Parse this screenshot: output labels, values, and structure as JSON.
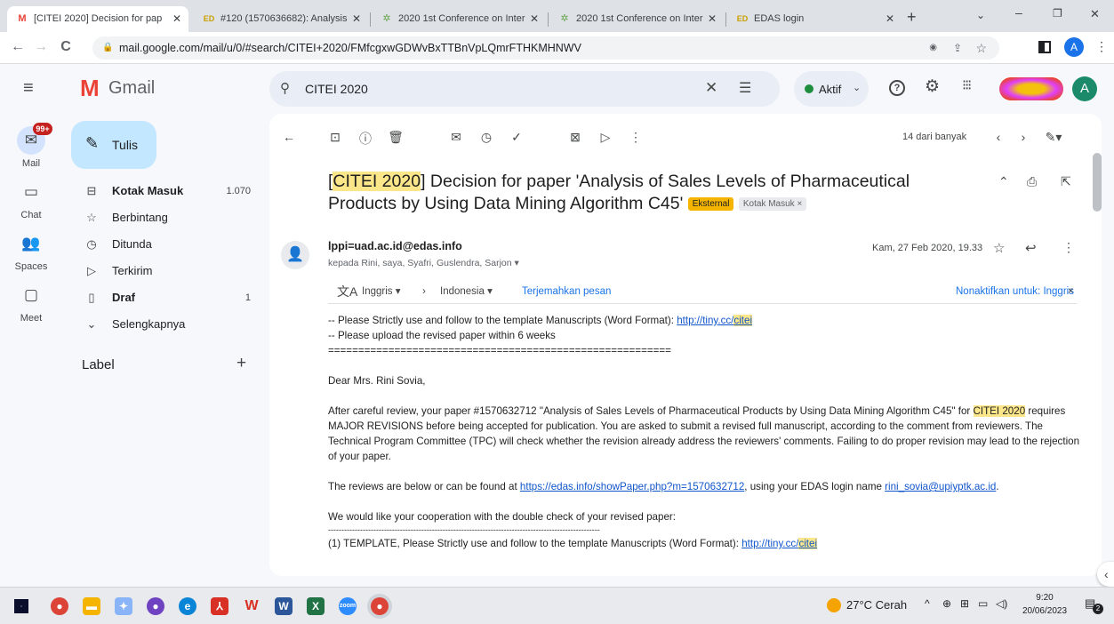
{
  "browser": {
    "tabs": [
      {
        "title": "[CITEI 2020] Decision for pap",
        "icon": "gmail-icon",
        "active": true
      },
      {
        "title": "#120 (1570636682): Analysis",
        "icon": "edas-icon",
        "active": false
      },
      {
        "title": "2020 1st Conference on Inter",
        "icon": "conference-icon",
        "active": false
      },
      {
        "title": "2020 1st Conference on Inter",
        "icon": "conference-icon",
        "active": false
      },
      {
        "title": "EDAS login",
        "icon": "edas-icon",
        "active": false
      }
    ],
    "url": "mail.google.com/mail/u/0/#search/CITEI+2020/FMfcgxwGDWvBxTTBnVpLQmrFTHKMHNWV",
    "profile_letter": "A"
  },
  "gmail": {
    "brand": "Gmail",
    "search_query": "CITEI 2020",
    "status": "Aktif",
    "avatar_letter": "A",
    "compose_label": "Tulis",
    "mail_badge": "99+",
    "rail": [
      {
        "label": "Mail",
        "icon": "mail-icon"
      },
      {
        "label": "Chat",
        "icon": "chat-icon"
      },
      {
        "label": "Spaces",
        "icon": "spaces-icon"
      },
      {
        "label": "Meet",
        "icon": "meet-icon"
      }
    ],
    "nav": [
      {
        "label": "Kotak Masuk",
        "count": "1.070",
        "bold": true,
        "icon": "inbox-icon"
      },
      {
        "label": "Berbintang",
        "count": "",
        "bold": false,
        "icon": "star-icon"
      },
      {
        "label": "Ditunda",
        "count": "",
        "bold": false,
        "icon": "clock-icon"
      },
      {
        "label": "Terkirim",
        "count": "",
        "bold": false,
        "icon": "send-icon"
      },
      {
        "label": "Draf",
        "count": "1",
        "bold": true,
        "icon": "draft-icon"
      },
      {
        "label": "Selengkapnya",
        "count": "",
        "bold": false,
        "icon": "chevron-down-icon"
      }
    ],
    "label_heading": "Label",
    "pager": "14 dari banyak"
  },
  "email": {
    "subject_tag": "CITEI 2020",
    "subject_rest_1": " Decision for paper 'Analysis of Sales Levels of Pharmaceutical",
    "subject_rest_2": "Products by Using Data Mining Algorithm C45'",
    "badge_external": "Eksternal",
    "badge_inbox": "Kotak Masuk",
    "sender": "lppi=uad.ac.id@edas.info",
    "recipients": "kepada Rini, saya, Syafri, Guslendra, Sarjon",
    "date": "Kam, 27 Feb 2020, 19.33",
    "translate": {
      "from_lang": "Inggris",
      "to_lang": "Indonesia",
      "translate_link": "Terjemahkan pesan",
      "disable_link": "Nonaktifkan untuk: Inggris"
    },
    "body": {
      "line1_prefix": "-- Please Strictly use and follow to the template Manuscripts (Word Format): ",
      "line1_link_a": "http://tiny.cc/",
      "line1_link_b": "citei",
      "line2": "-- Please upload the revised paper within 6 weeks",
      "separator": "=========================================================",
      "greeting": "Dear Mrs. Rini Sovia,",
      "para1_a": "After careful review, your paper #1570632712 \"Analysis of Sales Levels of Pharmaceutical Products by Using Data Mining Algorithm C45\" for ",
      "para1_hl": "CITEI 2020",
      "para1_b": " requires MAJOR REVISIONS before being accepted for publication. You are asked to submit a revised full manuscript, according to the comment from reviewers. The Technical Program Committee (TPC) will check whether the revision already address the reviewers' comments. Failing to do proper revision may lead to the rejection of your paper.",
      "para2_a": "The reviews are below or can be found at ",
      "para2_link": "https://edas.info/showPaper.php?m=1570632712",
      "para2_b": ", using your EDAS login name ",
      "para2_email": "rini_sovia@upiyptk.ac.id",
      "para2_c": ".",
      "para3": "We would like your cooperation with the double check of your revised paper:",
      "dashes": "------------------------------------------------------------------------------------------------------",
      "item1_prefix": "(1) TEMPLATE, Please Strictly use and follow to the template Manuscripts (Word Format): ",
      "item1_link_a": "http://tiny.cc/",
      "item1_link_b": "citei"
    }
  },
  "taskbar": {
    "weather": "27°C  Cerah",
    "time": "9:20",
    "date": "20/06/2023",
    "notif_count": "2"
  }
}
